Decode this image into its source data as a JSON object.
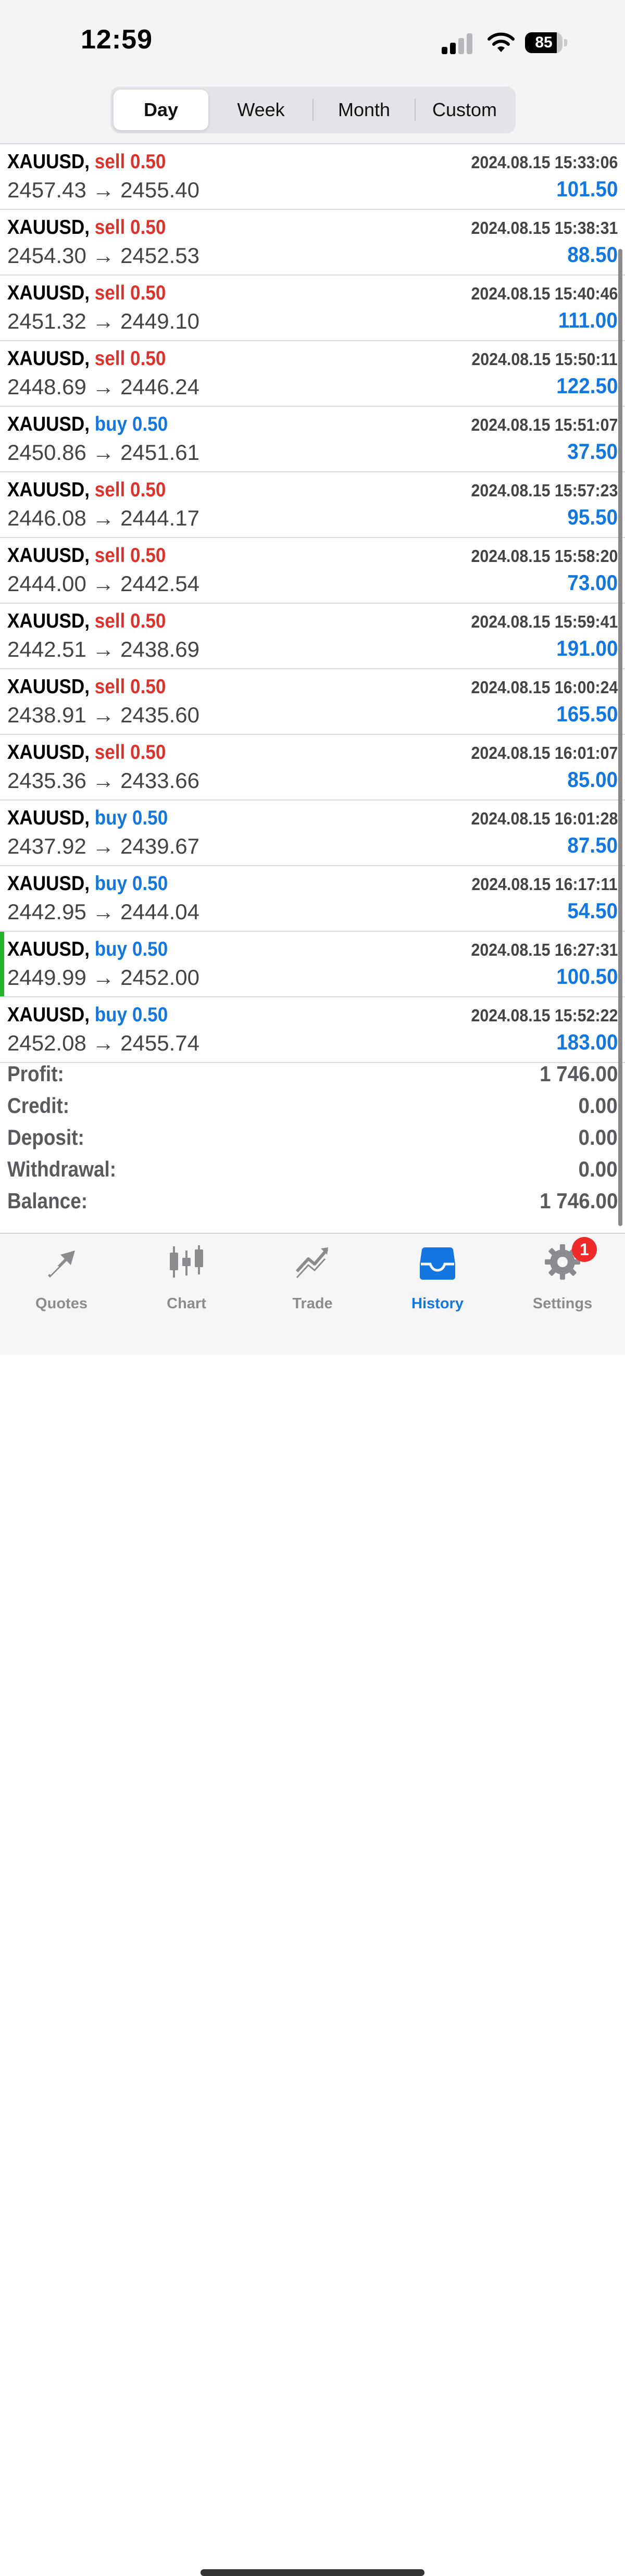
{
  "status_bar": {
    "time": "12:59",
    "battery": "85",
    "battery_level": 0.85
  },
  "period_tabs": [
    {
      "label": "Day",
      "active": true
    },
    {
      "label": "Week",
      "active": false
    },
    {
      "label": "Month",
      "active": false
    },
    {
      "label": "Custom",
      "active": false
    }
  ],
  "arrow": "→",
  "trades": [
    {
      "symbol": "XAUUSD,",
      "direction": "sell",
      "volume": "0.50",
      "open": "2457.43",
      "close": "2455.40",
      "time": "2024.08.15 15:33:06",
      "profit": "101.50"
    },
    {
      "symbol": "XAUUSD,",
      "direction": "sell",
      "volume": "0.50",
      "open": "2454.30",
      "close": "2452.53",
      "time": "2024.08.15 15:38:31",
      "profit": "88.50"
    },
    {
      "symbol": "XAUUSD,",
      "direction": "sell",
      "volume": "0.50",
      "open": "2451.32",
      "close": "2449.10",
      "time": "2024.08.15 15:40:46",
      "profit": "111.00"
    },
    {
      "symbol": "XAUUSD,",
      "direction": "sell",
      "volume": "0.50",
      "open": "2448.69",
      "close": "2446.24",
      "time": "2024.08.15 15:50:11",
      "profit": "122.50"
    },
    {
      "symbol": "XAUUSD,",
      "direction": "buy",
      "volume": "0.50",
      "open": "2450.86",
      "close": "2451.61",
      "time": "2024.08.15 15:51:07",
      "profit": "37.50"
    },
    {
      "symbol": "XAUUSD,",
      "direction": "sell",
      "volume": "0.50",
      "open": "2446.08",
      "close": "2444.17",
      "time": "2024.08.15 15:57:23",
      "profit": "95.50"
    },
    {
      "symbol": "XAUUSD,",
      "direction": "sell",
      "volume": "0.50",
      "open": "2444.00",
      "close": "2442.54",
      "time": "2024.08.15 15:58:20",
      "profit": "73.00"
    },
    {
      "symbol": "XAUUSD,",
      "direction": "sell",
      "volume": "0.50",
      "open": "2442.51",
      "close": "2438.69",
      "time": "2024.08.15 15:59:41",
      "profit": "191.00"
    },
    {
      "symbol": "XAUUSD,",
      "direction": "sell",
      "volume": "0.50",
      "open": "2438.91",
      "close": "2435.60",
      "time": "2024.08.15 16:00:24",
      "profit": "165.50"
    },
    {
      "symbol": "XAUUSD,",
      "direction": "sell",
      "volume": "0.50",
      "open": "2435.36",
      "close": "2433.66",
      "time": "2024.08.15 16:01:07",
      "profit": "85.00"
    },
    {
      "symbol": "XAUUSD,",
      "direction": "buy",
      "volume": "0.50",
      "open": "2437.92",
      "close": "2439.67",
      "time": "2024.08.15 16:01:28",
      "profit": "87.50"
    },
    {
      "symbol": "XAUUSD,",
      "direction": "buy",
      "volume": "0.50",
      "open": "2442.95",
      "close": "2444.04",
      "time": "2024.08.15 16:17:11",
      "profit": "54.50"
    },
    {
      "symbol": "XAUUSD,",
      "direction": "buy",
      "volume": "0.50",
      "open": "2449.99",
      "close": "2452.00",
      "time": "2024.08.15 16:27:31",
      "profit": "100.50",
      "highlighted": true
    },
    {
      "symbol": "XAUUSD,",
      "direction": "buy",
      "volume": "0.50",
      "open": "2452.08",
      "close": "2455.74",
      "time": "2024.08.15 15:52:22",
      "profit": "183.00"
    }
  ],
  "summary": [
    {
      "label": "Profit:",
      "value": "1 746.00"
    },
    {
      "label": "Credit:",
      "value": "0.00"
    },
    {
      "label": "Deposit:",
      "value": "0.00"
    },
    {
      "label": "Withdrawal:",
      "value": "0.00"
    },
    {
      "label": "Balance:",
      "value": "1 746.00"
    }
  ],
  "tabbar": [
    {
      "label": "Quotes",
      "icon": "quotes-arrows-icon",
      "active": false
    },
    {
      "label": "Chart",
      "icon": "candlestick-chart-icon",
      "active": false
    },
    {
      "label": "Trade",
      "icon": "trade-trend-icon",
      "active": false
    },
    {
      "label": "History",
      "icon": "history-inbox-icon",
      "active": true
    },
    {
      "label": "Settings",
      "icon": "gear-icon",
      "active": false,
      "badge": "1"
    }
  ],
  "colors": {
    "sell": "#e0312b",
    "buy": "#1277e0",
    "profit": "#1277e0",
    "active_tab": "#1277e0",
    "inactive_tab": "#8c8c90",
    "marker": "#24b42a",
    "badge": "#ef2a2a"
  }
}
